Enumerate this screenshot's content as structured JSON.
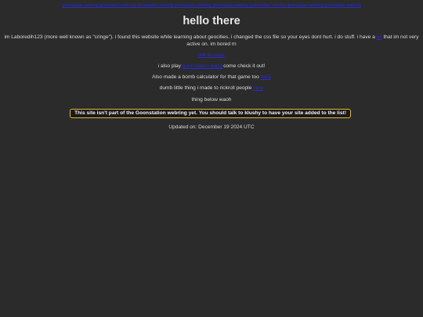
{
  "top_banner": {
    "link_text": "goonstation webring goonstation webring goonstation webring goonstation webring goonstation webring goonstation webring goonstation webring goonstation webring"
  },
  "header": {
    "title": "hello there"
  },
  "intro": {
    "text_before_link": "im Laboredih123 (more well known as \"cringe\"). i found this website while learning about geocities. i changed the css file so your eyes dont hurt. i do stuff. i have a ",
    "link_text": "git",
    "text_after_link": " that im not very active on. im bored rn"
  },
  "links": {
    "link_1": "link to page",
    "play_prefix": "i also play ",
    "play_link": "goonstation game",
    "play_suffix": "come check it out!",
    "calc_text": "Also made a bomb calculator for that game too ",
    "calc_link": "here",
    "rick_text": "dumb little thing i made to rickroll people ",
    "rick_link": "here",
    "thing_below": "thing below waoh"
  },
  "webring": {
    "notice": "This site isn't part of the Goonstation webring yet. You should talk to klushy to have your site added to the list!"
  },
  "footer": {
    "updated": "Updated on: December 19 2024 UTC"
  },
  "colors": {
    "background": "#2b2b2b",
    "link": "#2a2ad0",
    "webring_border": "#e3b92c"
  }
}
